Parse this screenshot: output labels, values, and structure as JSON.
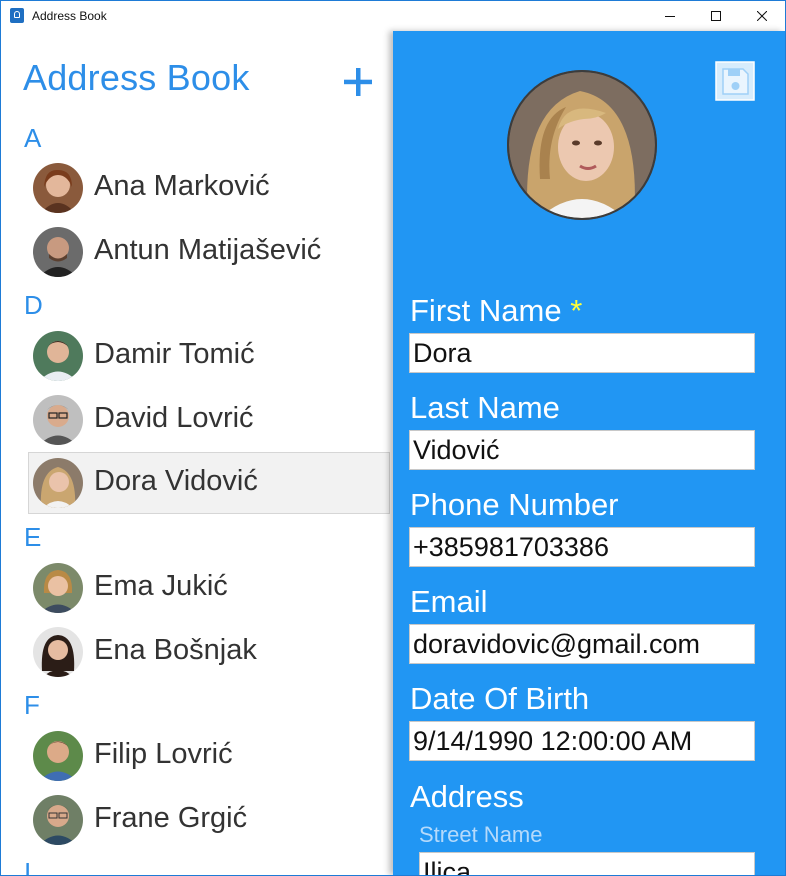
{
  "window": {
    "title": "Address Book"
  },
  "list": {
    "title": "Address Book",
    "groups": [
      {
        "letter": "A"
      },
      {
        "letter": "D"
      },
      {
        "letter": "E"
      },
      {
        "letter": "F"
      },
      {
        "letter": "I"
      }
    ],
    "contacts": [
      {
        "name": "Ana Marković"
      },
      {
        "name": "Antun Matijašević"
      },
      {
        "name": "Damir Tomić"
      },
      {
        "name": "David Lovrić"
      },
      {
        "name": "Dora Vidović",
        "selected": true
      },
      {
        "name": "Ema Jukić"
      },
      {
        "name": "Ena Bošnjak"
      },
      {
        "name": "Filip Lovrić"
      },
      {
        "name": "Frane Grgić"
      }
    ]
  },
  "detail": {
    "first_name_label": "First Name",
    "required_marker": "*",
    "first_name_value": "Dora",
    "last_name_label": "Last Name",
    "last_name_value": "Vidović",
    "phone_label": "Phone Number",
    "phone_value": "+385981703386",
    "email_label": "Email",
    "email_value": "doravidovic@gmail.com",
    "dob_label": "Date Of Birth",
    "dob_value": "9/14/1990 12:00:00 AM",
    "address_label": "Address",
    "street_label": "Street Name",
    "street_value": "Ilica"
  },
  "colors": {
    "accent": "#2d8ee8",
    "detail_background": "#2196f3",
    "required": "#ffff3a",
    "selection": "#f2f2f2"
  },
  "icons": {
    "add": "plus-icon",
    "save": "save-icon",
    "app": "address-book-icon"
  }
}
